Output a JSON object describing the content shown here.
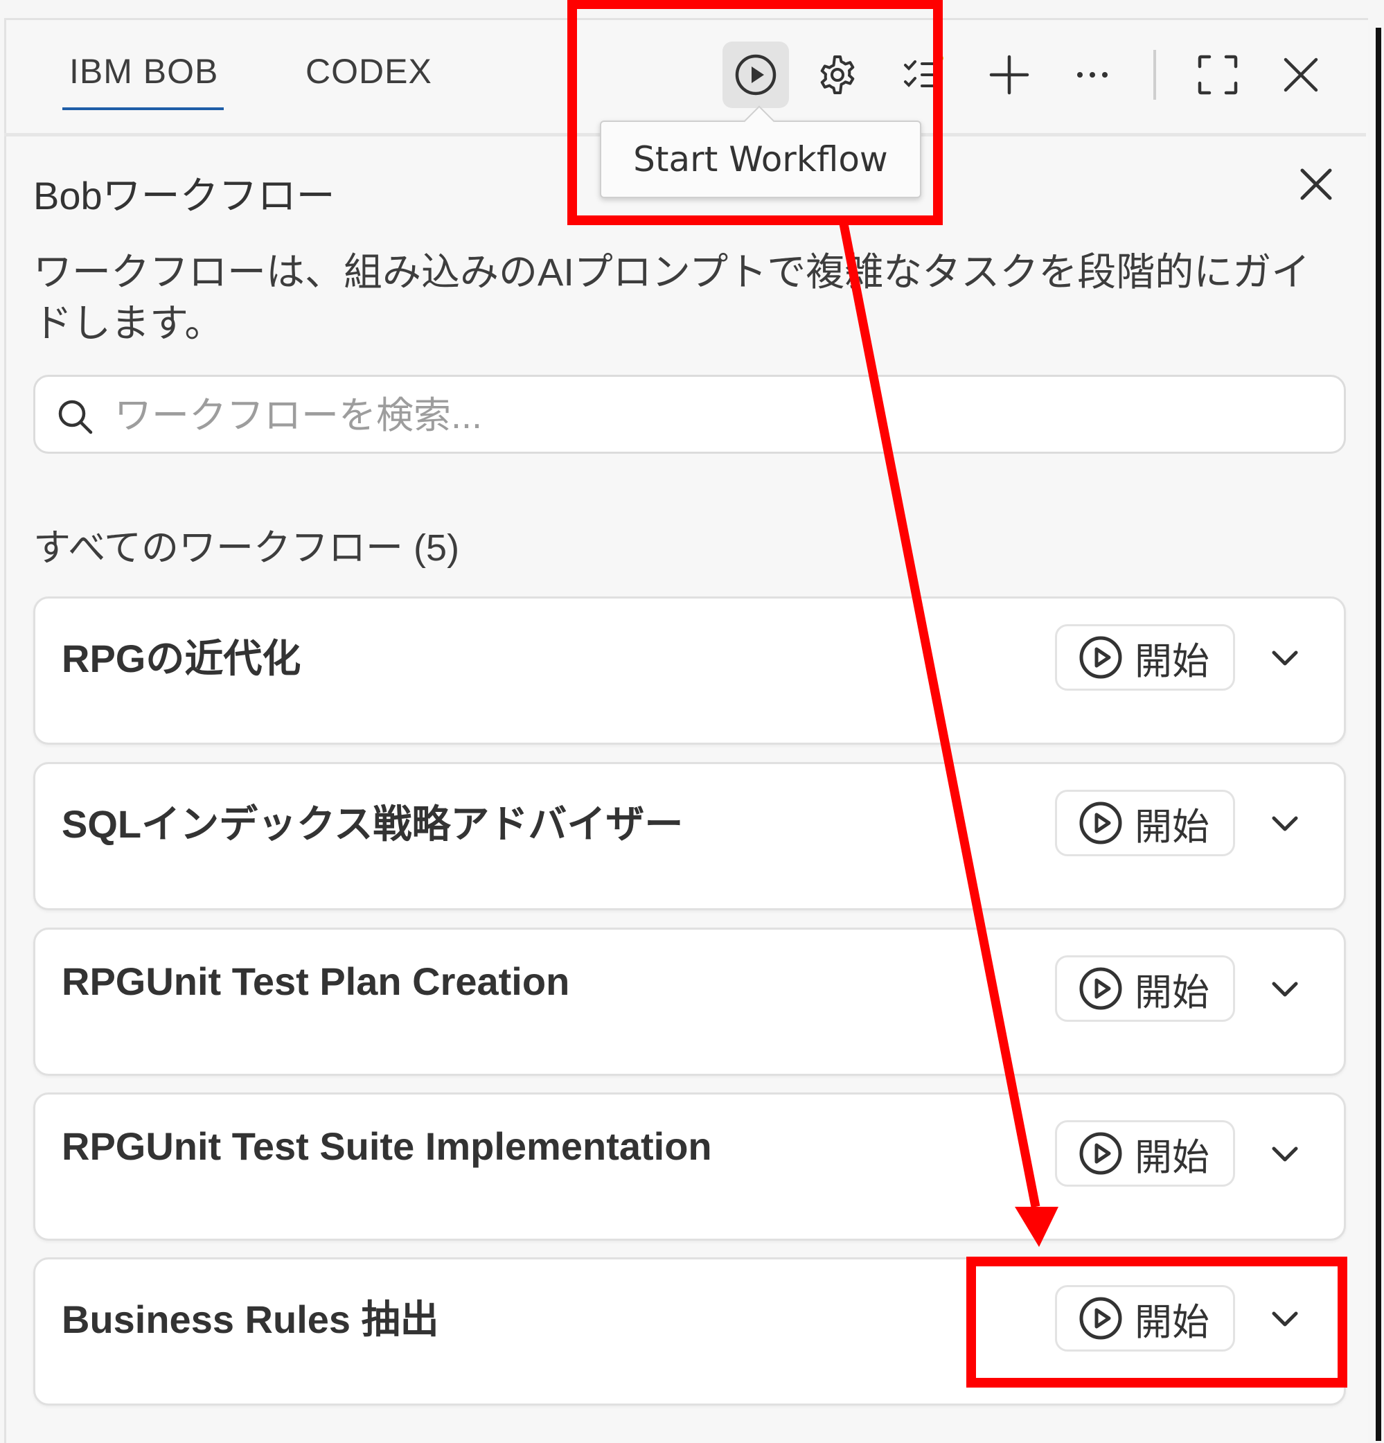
{
  "tabs": [
    {
      "label": "IBM BOB",
      "active": true
    },
    {
      "label": "CODEX",
      "active": false
    }
  ],
  "toolbar": {
    "icons": [
      "play-circle-icon",
      "gear-icon",
      "checklist-icon",
      "plus-icon",
      "more-icon",
      "expand-icon",
      "close-icon"
    ],
    "tooltip": "Start Workflow"
  },
  "panel": {
    "title": "Bobワークフロー",
    "description": "ワークフローは、組み込みのAIプロンプトで複雑なタスクを段階的にガイドします。",
    "search_placeholder": "ワークフローを検索...",
    "section_heading": "すべてのワークフロー (5)"
  },
  "workflows": [
    {
      "title": "RPGの近代化",
      "start_label": "開始"
    },
    {
      "title": "SQLインデックス戦略アドバイザー",
      "start_label": "開始"
    },
    {
      "title": "RPGUnit Test Plan Creation",
      "start_label": "開始"
    },
    {
      "title": "RPGUnit Test Suite Implementation",
      "start_label": "開始"
    },
    {
      "title": "Business Rules 抽出",
      "start_label": "開始"
    }
  ],
  "colors": {
    "accent_underline": "#1f5ea8",
    "annotation_red": "#ff0000"
  }
}
